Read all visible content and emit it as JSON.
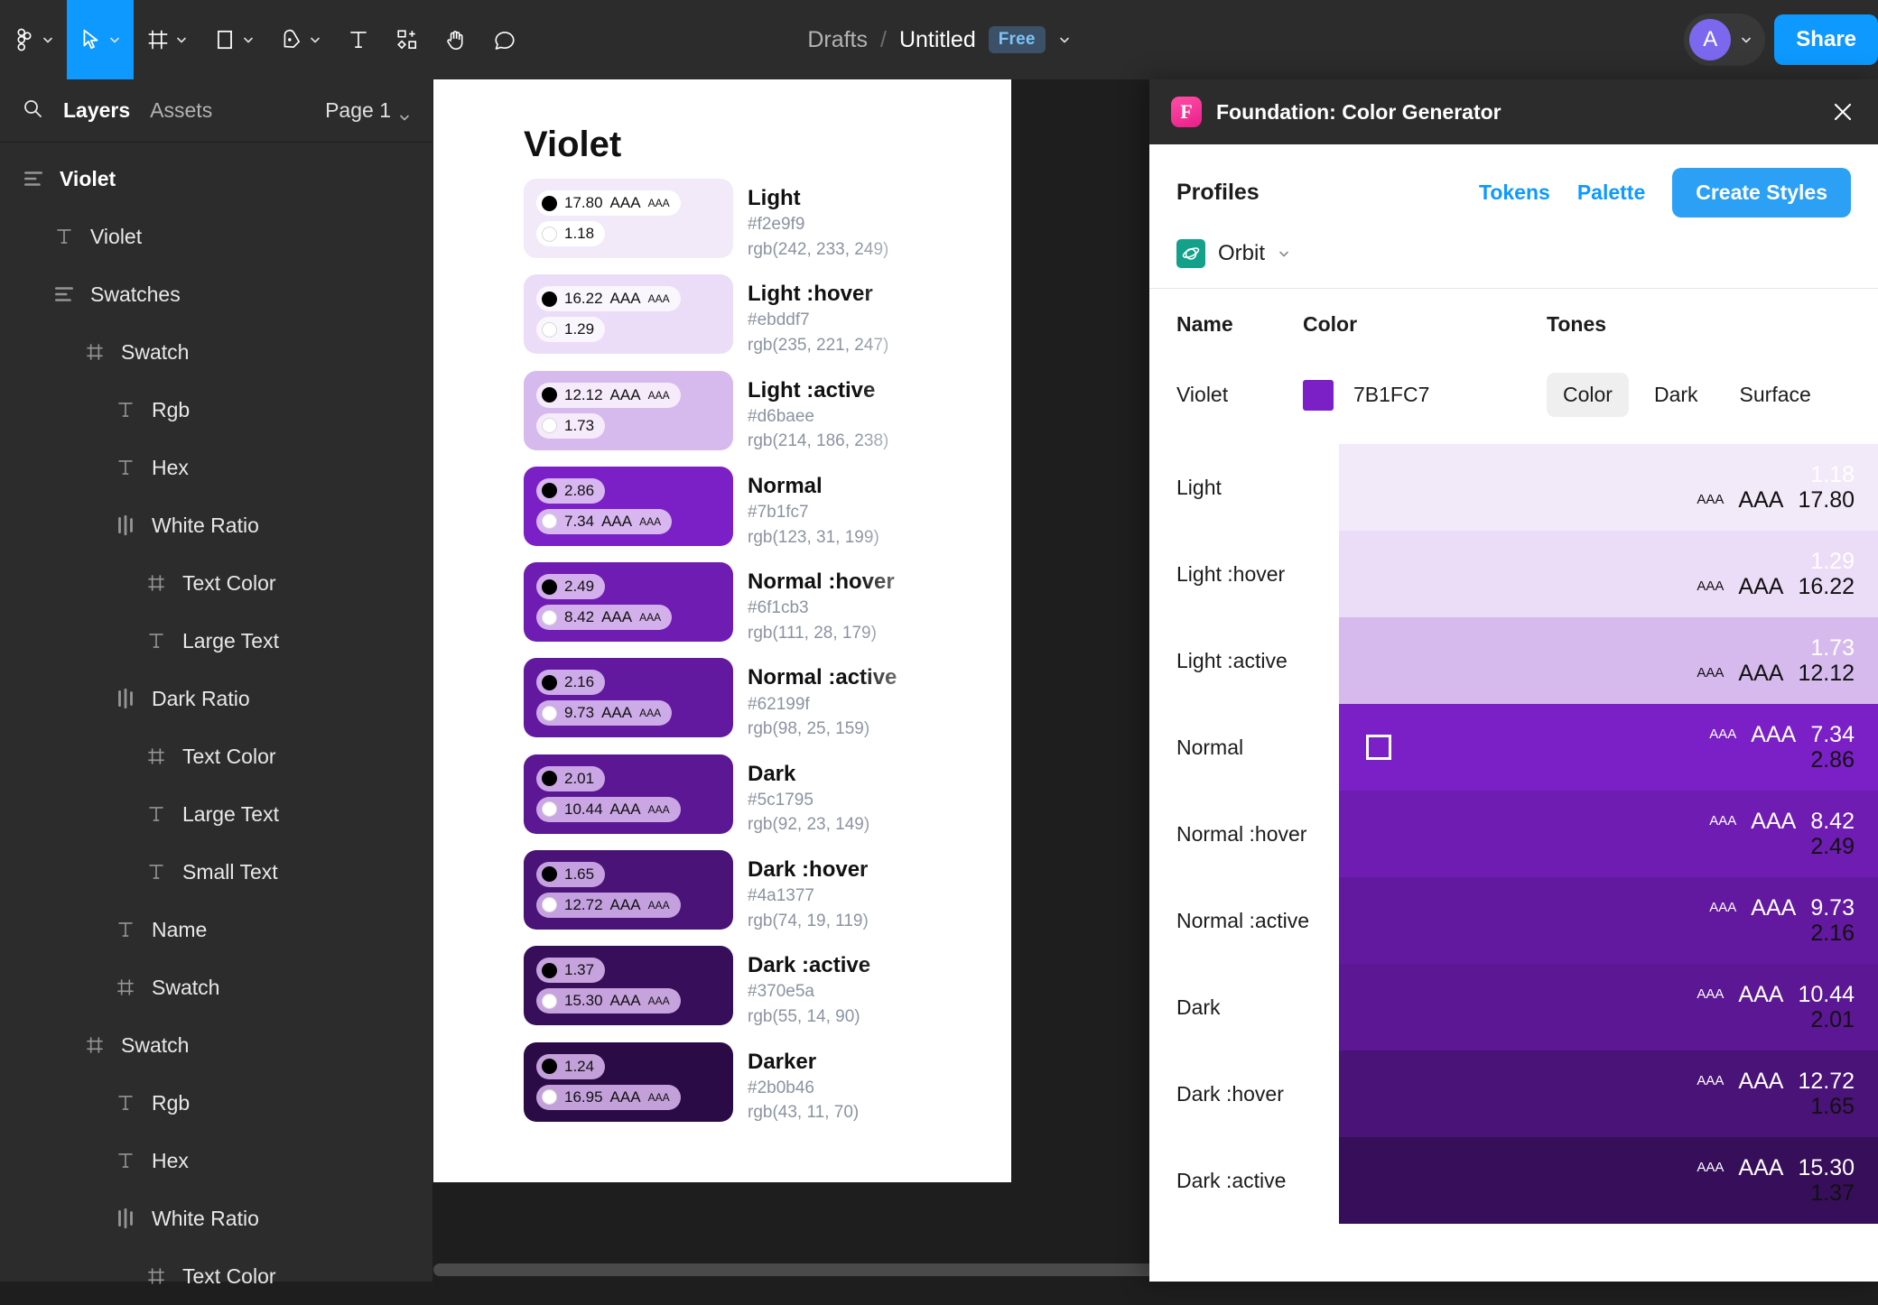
{
  "toolbar": {
    "tools": [
      {
        "name": "figma-logo-icon",
        "caret": true,
        "active": false
      },
      {
        "name": "move-tool-icon",
        "caret": true,
        "active": true
      },
      {
        "name": "frame-tool-icon",
        "caret": true,
        "active": false
      },
      {
        "name": "shape-tool-icon",
        "caret": true,
        "active": false
      },
      {
        "name": "pen-tool-icon",
        "caret": true,
        "active": false
      },
      {
        "name": "text-tool-icon",
        "caret": false,
        "active": false
      },
      {
        "name": "components-tool-icon",
        "caret": false,
        "active": false
      },
      {
        "name": "hand-tool-icon",
        "caret": false,
        "active": false
      },
      {
        "name": "comment-tool-icon",
        "caret": false,
        "active": false
      }
    ],
    "breadcrumb_project": "Drafts",
    "breadcrumb_separator": "/",
    "breadcrumb_file": "Untitled",
    "plan_badge": "Free",
    "avatar_initial": "A",
    "share_label": "Share",
    "accent_blue": "#0d99ff"
  },
  "sidebar": {
    "tabs": [
      {
        "label": "Layers",
        "active": true
      },
      {
        "label": "Assets",
        "active": false
      }
    ],
    "page_selector": "Page 1",
    "layers": [
      {
        "label": "Violet",
        "icon": "auto-layout-vertical-icon",
        "depth": 0,
        "bold": true
      },
      {
        "label": "Violet",
        "icon": "text-layer-icon",
        "depth": 1,
        "bold": false
      },
      {
        "label": "Swatches",
        "icon": "auto-layout-vertical-icon",
        "depth": 1,
        "bold": false
      },
      {
        "label": "Swatch",
        "icon": "frame-layer-icon",
        "depth": 2,
        "bold": false
      },
      {
        "label": "Rgb",
        "icon": "text-layer-icon",
        "depth": 3,
        "bold": false
      },
      {
        "label": "Hex",
        "icon": "text-layer-icon",
        "depth": 3,
        "bold": false
      },
      {
        "label": "White Ratio",
        "icon": "auto-layout-horizontal-icon",
        "depth": 3,
        "bold": false
      },
      {
        "label": "Text Color",
        "icon": "frame-layer-icon",
        "depth": 4,
        "bold": false
      },
      {
        "label": "Large Text",
        "icon": "text-layer-icon",
        "depth": 4,
        "bold": false
      },
      {
        "label": "Dark Ratio",
        "icon": "auto-layout-horizontal-icon",
        "depth": 3,
        "bold": false
      },
      {
        "label": "Text Color",
        "icon": "frame-layer-icon",
        "depth": 4,
        "bold": false
      },
      {
        "label": "Large Text",
        "icon": "text-layer-icon",
        "depth": 4,
        "bold": false
      },
      {
        "label": "Small Text",
        "icon": "text-layer-icon",
        "depth": 4,
        "bold": false
      },
      {
        "label": "Name",
        "icon": "text-layer-icon",
        "depth": 3,
        "bold": false
      },
      {
        "label": "Swatch",
        "icon": "frame-layer-icon",
        "depth": 3,
        "bold": false
      },
      {
        "label": "Swatch",
        "icon": "frame-layer-icon",
        "depth": 2,
        "bold": false
      },
      {
        "label": "Rgb",
        "icon": "text-layer-icon",
        "depth": 3,
        "bold": false
      },
      {
        "label": "Hex",
        "icon": "text-layer-icon",
        "depth": 3,
        "bold": false
      },
      {
        "label": "White Ratio",
        "icon": "auto-layout-horizontal-icon",
        "depth": 3,
        "bold": false
      },
      {
        "label": "Text Color",
        "icon": "frame-layer-icon",
        "depth": 4,
        "bold": false
      }
    ]
  },
  "canvas": {
    "artboard_title": "Violet",
    "swatches": [
      {
        "name": "Light",
        "hex": "#f2e9f9",
        "rgb": "rgb(242, 233, 249)",
        "bg": "#f2e9f9",
        "pill_bg": "#ffffff",
        "rows": [
          {
            "dot": "black",
            "ratio": "17.80",
            "aaa_large": "AAA",
            "aaa_small": "AAA"
          },
          {
            "dot": "white",
            "ratio": "1.18",
            "aaa_large": "",
            "aaa_small": ""
          }
        ]
      },
      {
        "name": "Light :hover",
        "hex": "#ebddf7",
        "rgb": "rgb(235, 221, 247)",
        "bg": "#ebddf7",
        "pill_bg": "#faf6fd",
        "rows": [
          {
            "dot": "black",
            "ratio": "16.22",
            "aaa_large": "AAA",
            "aaa_small": "AAA"
          },
          {
            "dot": "white",
            "ratio": "1.29",
            "aaa_large": "",
            "aaa_small": ""
          }
        ]
      },
      {
        "name": "Light :active",
        "hex": "#d6baee",
        "rgb": "rgb(214, 186, 238)",
        "bg": "#d6baee",
        "pill_bg": "#f5ebfb",
        "rows": [
          {
            "dot": "black",
            "ratio": "12.12",
            "aaa_large": "AAA",
            "aaa_small": "AAA"
          },
          {
            "dot": "white",
            "ratio": "1.73",
            "aaa_large": "",
            "aaa_small": ""
          }
        ]
      },
      {
        "name": "Normal",
        "hex": "#7b1fc7",
        "rgb": "rgb(123, 31, 199)",
        "bg": "#7b1fc7",
        "pill_bg": "#d8b6f0",
        "rows": [
          {
            "dot": "black",
            "ratio": "2.86",
            "aaa_large": "",
            "aaa_small": ""
          },
          {
            "dot": "white",
            "ratio": "7.34",
            "aaa_large": "AAA",
            "aaa_small": "AAA"
          }
        ]
      },
      {
        "name": "Normal :hover",
        "hex": "#6f1cb3",
        "rgb": "rgb(111, 28, 179)",
        "bg": "#6f1cb3",
        "pill_bg": "#d3b0ec",
        "rows": [
          {
            "dot": "black",
            "ratio": "2.49",
            "aaa_large": "",
            "aaa_small": ""
          },
          {
            "dot": "white",
            "ratio": "8.42",
            "aaa_large": "AAA",
            "aaa_small": "AAA"
          }
        ]
      },
      {
        "name": "Normal :active",
        "hex": "#62199f",
        "rgb": "rgb(98, 25, 159)",
        "bg": "#62199f",
        "pill_bg": "#cdaae8",
        "rows": [
          {
            "dot": "black",
            "ratio": "2.16",
            "aaa_large": "",
            "aaa_small": ""
          },
          {
            "dot": "white",
            "ratio": "9.73",
            "aaa_large": "AAA",
            "aaa_small": "AAA"
          }
        ]
      },
      {
        "name": "Dark",
        "hex": "#5c1795",
        "rgb": "rgb(92, 23, 149)",
        "bg": "#5c1795",
        "pill_bg": "#caa6e5",
        "rows": [
          {
            "dot": "black",
            "ratio": "2.01",
            "aaa_large": "",
            "aaa_small": ""
          },
          {
            "dot": "white",
            "ratio": "10.44",
            "aaa_large": "AAA",
            "aaa_small": "AAA"
          }
        ]
      },
      {
        "name": "Dark :hover",
        "hex": "#4a1377",
        "rgb": "rgb(74, 19, 119)",
        "bg": "#4a1377",
        "pill_bg": "#c4a0e0",
        "rows": [
          {
            "dot": "black",
            "ratio": "1.65",
            "aaa_large": "",
            "aaa_small": ""
          },
          {
            "dot": "white",
            "ratio": "12.72",
            "aaa_large": "AAA",
            "aaa_small": "AAA"
          }
        ]
      },
      {
        "name": "Dark :active",
        "hex": "#370e5a",
        "rgb": "rgb(55, 14, 90)",
        "bg": "#370e5a",
        "pill_bg": "#c6a3dd",
        "rows": [
          {
            "dot": "black",
            "ratio": "1.37",
            "aaa_large": "",
            "aaa_small": ""
          },
          {
            "dot": "white",
            "ratio": "15.30",
            "aaa_large": "AAA",
            "aaa_small": "AAA"
          }
        ]
      },
      {
        "name": "Darker",
        "hex": "#2b0b46",
        "rgb": "rgb(43, 11, 70)",
        "bg": "#2b0b46",
        "pill_bg": "#c3a0da",
        "rows": [
          {
            "dot": "black",
            "ratio": "1.24",
            "aaa_large": "",
            "aaa_small": ""
          },
          {
            "dot": "white",
            "ratio": "16.95",
            "aaa_large": "AAA",
            "aaa_small": "AAA"
          }
        ]
      }
    ]
  },
  "plugin": {
    "icon": "foundation-plugin-icon",
    "icon_letter": "F",
    "title": "Foundation: Color Generator",
    "close_icon": "close-icon",
    "profiles_label": "Profiles",
    "tokens_label": "Tokens",
    "palette_label": "Palette",
    "create_styles_label": "Create Styles",
    "profile_name": "Orbit",
    "profile_icon": "orbit-icon",
    "profile_icon_color": "#14a18a",
    "columns": {
      "name": "Name",
      "color": "Color",
      "tones": "Tones"
    },
    "row": {
      "name": "Violet",
      "color_hex": "7B1FC7",
      "color_swatch": "#7b1fc7",
      "tones": [
        {
          "label": "Color",
          "selected": true
        },
        {
          "label": "Dark",
          "selected": false
        },
        {
          "label": "Surface",
          "selected": false
        }
      ]
    },
    "scale": [
      {
        "label": "Light",
        "bg": "#f2e9f9",
        "white_ratio": "1.18",
        "black_ratio": "17.80",
        "aaa_small": "AAA",
        "aaa_large": "AAA",
        "ratio_color": "black",
        "marker": false
      },
      {
        "label": "Light :hover",
        "bg": "#ebddf7",
        "white_ratio": "1.29",
        "black_ratio": "16.22",
        "aaa_small": "AAA",
        "aaa_large": "AAA",
        "ratio_color": "black",
        "marker": false
      },
      {
        "label": "Light :active",
        "bg": "#d6baee",
        "white_ratio": "1.73",
        "black_ratio": "12.12",
        "aaa_small": "AAA",
        "aaa_large": "AAA",
        "ratio_color": "black",
        "marker": false
      },
      {
        "label": "Normal",
        "bg": "#7b1fc7",
        "white_ratio": "7.34",
        "black_ratio": "2.86",
        "aaa_small": "AAA",
        "aaa_large": "AAA",
        "ratio_color": "white",
        "marker": true
      },
      {
        "label": "Normal :hover",
        "bg": "#6f1cb3",
        "white_ratio": "8.42",
        "black_ratio": "2.49",
        "aaa_small": "AAA",
        "aaa_large": "AAA",
        "ratio_color": "white",
        "marker": false
      },
      {
        "label": "Normal :active",
        "bg": "#62199f",
        "white_ratio": "9.73",
        "black_ratio": "2.16",
        "aaa_small": "AAA",
        "aaa_large": "AAA",
        "ratio_color": "white",
        "marker": false
      },
      {
        "label": "Dark",
        "bg": "#5c1795",
        "white_ratio": "10.44",
        "black_ratio": "2.01",
        "aaa_small": "AAA",
        "aaa_large": "AAA",
        "ratio_color": "white",
        "marker": false
      },
      {
        "label": "Dark :hover",
        "bg": "#4a1377",
        "white_ratio": "12.72",
        "black_ratio": "1.65",
        "aaa_small": "AAA",
        "aaa_large": "AAA",
        "ratio_color": "white",
        "marker": false
      },
      {
        "label": "Dark :active",
        "bg": "#370e5a",
        "white_ratio": "15.30",
        "black_ratio": "1.37",
        "aaa_small": "AAA",
        "aaa_large": "AAA",
        "ratio_color": "white",
        "marker": false
      }
    ]
  }
}
